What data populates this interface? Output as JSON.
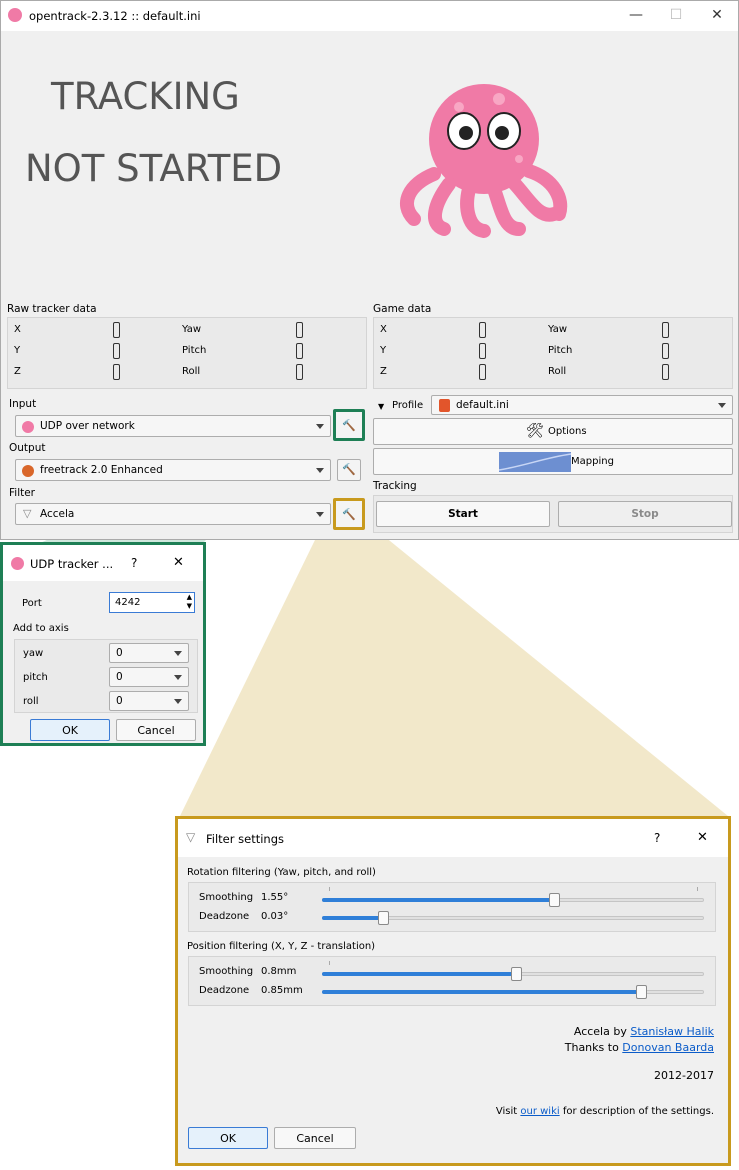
{
  "window": {
    "title": "opentrack-2.3.12 :: default.ini",
    "minimize": "—",
    "maximize": "☐",
    "close": "✕"
  },
  "status": {
    "line1": "TRACKING",
    "line2": "NOT STARTED"
  },
  "raw_tracker": {
    "label": "Raw tracker data",
    "rows": [
      {
        "left": "X",
        "right": "Yaw"
      },
      {
        "left": "Y",
        "right": "Pitch"
      },
      {
        "left": "Z",
        "right": "Roll"
      }
    ]
  },
  "game_data": {
    "label": "Game data",
    "rows": [
      {
        "left": "X",
        "right": "Yaw"
      },
      {
        "left": "Y",
        "right": "Pitch"
      },
      {
        "left": "Z",
        "right": "Roll"
      }
    ]
  },
  "input": {
    "label": "Input",
    "value": "UDP over network"
  },
  "output": {
    "label": "Output",
    "value": "freetrack 2.0 Enhanced"
  },
  "filter": {
    "label": "Filter",
    "value": "Accela"
  },
  "profile": {
    "label": "Profile",
    "value": "default.ini"
  },
  "options_label": "Options",
  "mapping_label": "Mapping",
  "tracking": {
    "label": "Tracking",
    "start": "Start",
    "stop": "Stop"
  },
  "udp_dialog": {
    "title": "UDP tracker ...",
    "help": "?",
    "close": "✕",
    "port_label": "Port",
    "port_value": "4242",
    "axis_label": "Add to axis",
    "axes": [
      {
        "name": "yaw",
        "value": "0"
      },
      {
        "name": "pitch",
        "value": "0"
      },
      {
        "name": "roll",
        "value": "0"
      }
    ],
    "ok": "OK",
    "cancel": "Cancel"
  },
  "filter_dialog": {
    "title": "Filter settings",
    "help": "?",
    "close": "✕",
    "rotation_label": "Rotation filtering (Yaw, pitch, and roll)",
    "position_label": "Position filtering (X, Y, Z - translation)",
    "rotation": [
      {
        "name": "Smoothing",
        "value": "1.55°",
        "level": 0.61
      },
      {
        "name": "Deadzone",
        "value": "0.03°",
        "level": 0.16
      }
    ],
    "position": [
      {
        "name": "Smoothing",
        "value": "0.8mm",
        "level": 0.51
      },
      {
        "name": "Deadzone",
        "value": "0.85mm",
        "level": 0.84
      }
    ],
    "credit_prefix": "Accela by ",
    "credit_author": "Stanisław Halik",
    "thanks_prefix": "Thanks to ",
    "thanks_author": "Donovan Baarda",
    "years": "2012-2017",
    "wiki_prefix": "Visit ",
    "wiki_link": "our wiki",
    "wiki_suffix": " for description of the settings.",
    "ok": "OK",
    "cancel": "Cancel"
  },
  "colors": {
    "green_highlight": "#1e7f55",
    "gold_highlight": "#c89a1e",
    "slider_fill": "#2f7fd8"
  }
}
